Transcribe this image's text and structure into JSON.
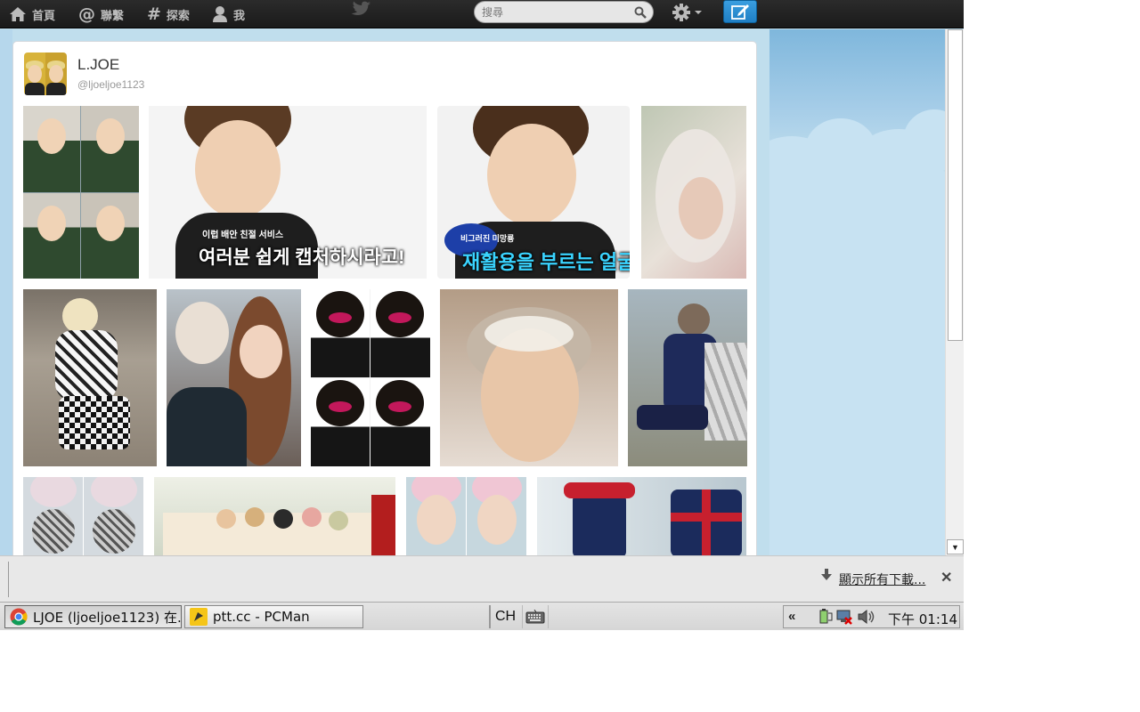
{
  "topbar": {
    "nav": [
      {
        "label": "首頁",
        "icon": "home-icon"
      },
      {
        "label": "聯繫",
        "icon": "at-icon"
      },
      {
        "label": "探索",
        "icon": "hashtag-icon"
      },
      {
        "label": "我",
        "icon": "person-icon"
      }
    ],
    "search_placeholder": "搜尋",
    "colors": {
      "bar": "#1a1a1a",
      "compose": "#1f7fc4"
    }
  },
  "profile": {
    "display_name": "L.JOE",
    "screen_name": "@ljoeljoe1123"
  },
  "media_grid": {
    "rows": [
      {
        "count": 4
      },
      {
        "count": 5
      },
      {
        "count": 4
      }
    ],
    "captions": {
      "photo2_top": "이럽 배안 친절 서비스",
      "photo2_main": "여러분 쉽게 캡처하시라고!",
      "photo3_top": "비그러진 미망룡",
      "photo3_main": "재활용을 부르는 얼굴"
    }
  },
  "download_bar": {
    "show_all": "顯示所有下載..."
  },
  "taskbar": {
    "tasks": [
      {
        "label": "LJOE (ljoeljoe1123) 在...",
        "icon": "chrome-icon"
      },
      {
        "label": "ptt.cc - PCMan",
        "icon": "pcman-icon"
      }
    ],
    "ime": "CH",
    "clock": "下午 01:14"
  }
}
